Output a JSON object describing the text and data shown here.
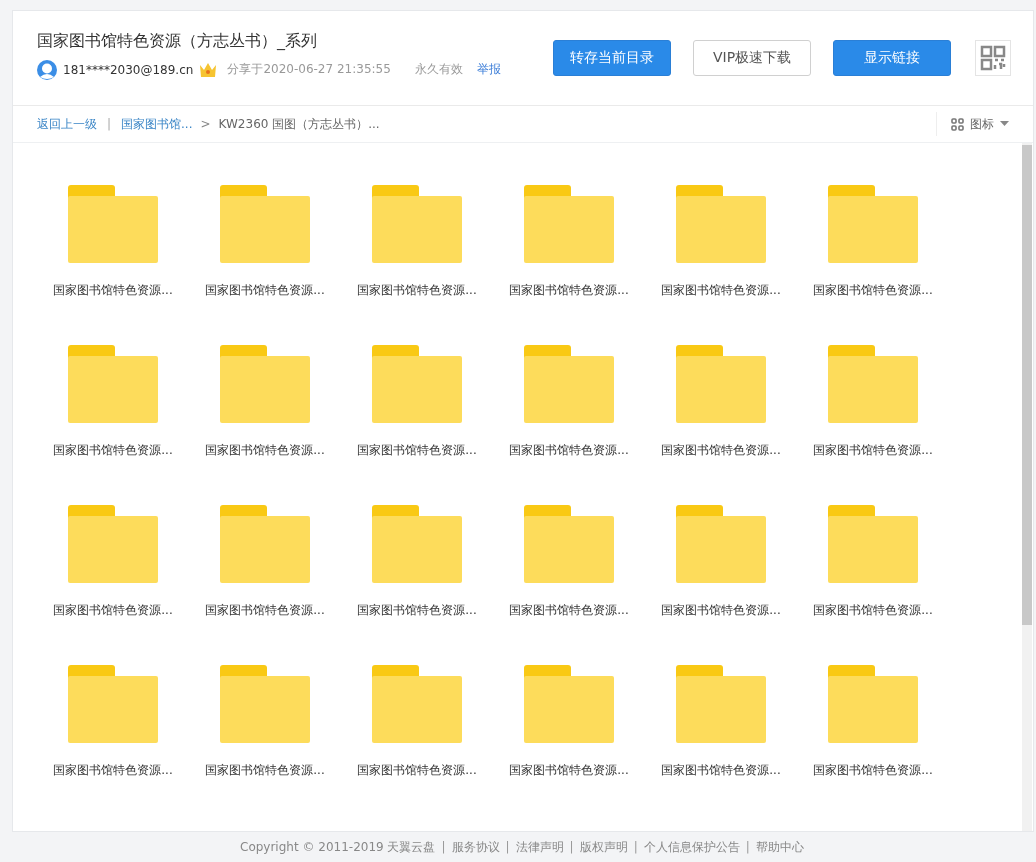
{
  "share": {
    "title": "国家图书馆特色资源（方志丛书）_系列",
    "user": "181****2030@189.cn",
    "shared_at": "分享于2020-06-27 21:35:55",
    "validity": "永久有效",
    "report_link": "举报"
  },
  "actions": [
    {
      "label": "转存当前目录",
      "kind": "primary"
    },
    {
      "label": "VIP极速下载",
      "kind": "secondary"
    },
    {
      "label": "显示链接",
      "kind": "primary"
    }
  ],
  "breadcrumb": {
    "back": "返回上一级",
    "divider": "|",
    "path": [
      {
        "label": "国家图书馆...",
        "kind": "link"
      },
      {
        "separator": ">",
        "label": "KW2360 国图（方志丛书）...",
        "kind": "current"
      }
    ]
  },
  "view_menu": {
    "label": "图标"
  },
  "folders": [
    {
      "name": "国家图书馆特色资源..."
    },
    {
      "name": "国家图书馆特色资源..."
    },
    {
      "name": "国家图书馆特色资源..."
    },
    {
      "name": "国家图书馆特色资源..."
    },
    {
      "name": "国家图书馆特色资源..."
    },
    {
      "name": "国家图书馆特色资源..."
    },
    {
      "name": "国家图书馆特色资源..."
    },
    {
      "name": "国家图书馆特色资源..."
    },
    {
      "name": "国家图书馆特色资源..."
    },
    {
      "name": "国家图书馆特色资源..."
    },
    {
      "name": "国家图书馆特色资源..."
    },
    {
      "name": "国家图书馆特色资源..."
    },
    {
      "name": "国家图书馆特色资源..."
    },
    {
      "name": "国家图书馆特色资源..."
    },
    {
      "name": "国家图书馆特色资源..."
    },
    {
      "name": "国家图书馆特色资源..."
    },
    {
      "name": "国家图书馆特色资源..."
    },
    {
      "name": "国家图书馆特色资源..."
    },
    {
      "name": "国家图书馆特色资源..."
    },
    {
      "name": "国家图书馆特色资源..."
    },
    {
      "name": "国家图书馆特色资源..."
    },
    {
      "name": "国家图书馆特色资源..."
    },
    {
      "name": "国家图书馆特色资源..."
    },
    {
      "name": "国家图书馆特色资源..."
    }
  ],
  "footer": {
    "copyright": "Copyright © 2011-2019 天翼云盘",
    "links": [
      {
        "separator": "|",
        "label": "服务协议"
      },
      {
        "separator": "|",
        "label": "法律声明"
      },
      {
        "separator": "|",
        "label": "版权声明"
      },
      {
        "separator": "|",
        "label": "个人信息保护公告"
      },
      {
        "separator": "|",
        "label": "帮助中心"
      }
    ]
  }
}
